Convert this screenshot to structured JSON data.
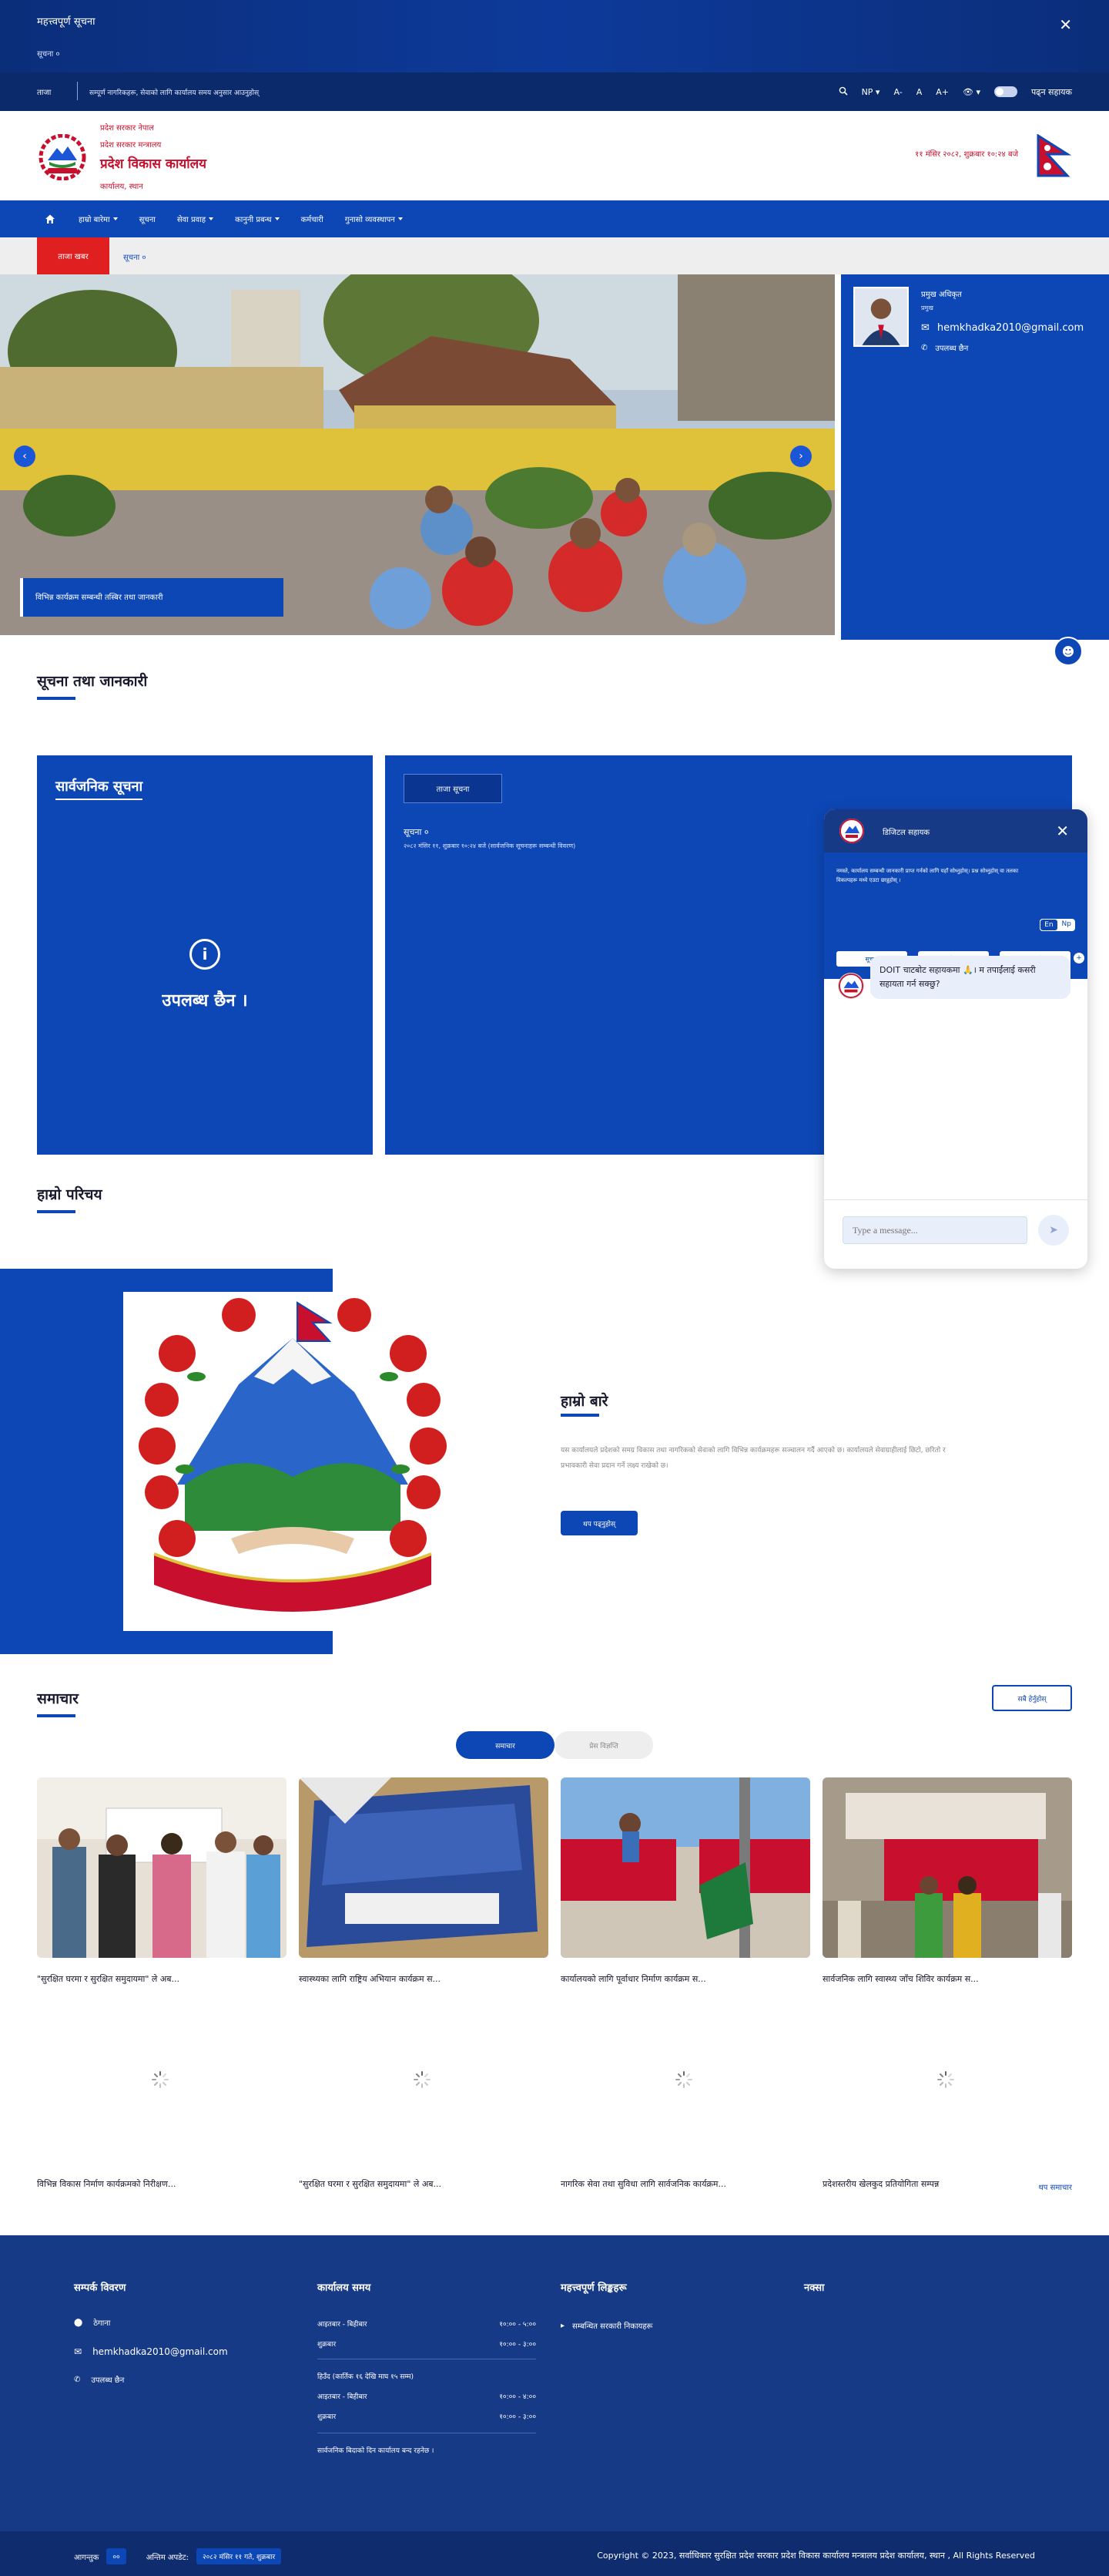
{
  "notice_bar": {
    "title": "महत्त्वपूर्ण सूचना",
    "link": "सूचना ०",
    "close": "✕"
  },
  "util_bar": {
    "label": "ताजा",
    "marquee": "सम्पूर्ण नागरिकहरू, सेवाको लागि कार्यालय समय अनुसार आउनुहोस्",
    "lang": "NP",
    "font_minus": "A-",
    "font_default": "A",
    "font_plus": "A+",
    "theme_label": "डार्क मोड",
    "accessibility": "पढ्न सहायक"
  },
  "header": {
    "line1": "प्रदेश सरकार नेपाल",
    "line2": "प्रदेश सरकार मन्त्रालय",
    "line3": "प्रदेश विकास कार्यालय",
    "line4": "कार्यालय, स्थान",
    "date": "११ मंसिर २०८२, शुक्रबार १०:२४ बजे"
  },
  "nav": {
    "items": [
      {
        "label": "हाम्रो बारेमा",
        "dropdown": true
      },
      {
        "label": "सूचना",
        "dropdown": false
      },
      {
        "label": "सेवा प्रवाह",
        "dropdown": true
      },
      {
        "label": "कानुनी प्रबन्ध",
        "dropdown": true
      },
      {
        "label": "कर्मचारी",
        "dropdown": false
      },
      {
        "label": "गुनासो व्यवस्थापन",
        "dropdown": true
      }
    ]
  },
  "breaking": {
    "tag": "ताजा खबर",
    "text": "सूचना ०"
  },
  "hero": {
    "caption": "विभिन्न कार्यक्रम सम्बन्धी तस्बिर तथा जानकारी",
    "prev": "‹",
    "next": "›"
  },
  "official": {
    "name": "प्रमुख अधिकृत",
    "title": "प्रमुख",
    "email": "hemkhadka2010@gmail.com",
    "phone": "उपलब्ध छैन"
  },
  "sections": {
    "notices_title": "सूचना तथा जानकारी",
    "intro_heading": "हाम्रो परिचय",
    "news_title": "समाचार"
  },
  "notice_left": {
    "title": "सार्वजनिक सूचना",
    "empty": "उपलब्ध छैन ।"
  },
  "notice_right": {
    "tab": "ताजा सूचना",
    "item_title": "सूचना ०",
    "item_sub": "२०८२ मंसिर ११, शुक्रबार १०:२४ बजे (सार्वजनिक सूचनाहरू सम्बन्धी विवरण)"
  },
  "intro": {
    "title": "हाम्रो बारे",
    "text": "यस कार्यालयले प्रदेशको समग्र विकास तथा नागरिकको सेवाको लागि विभिन्न कार्यक्रमहरू सञ्चालन गर्दै आएको छ। कार्यालयले सेवाग्राहीलाई छिटो, छरितो र प्रभावकारी सेवा प्रदान गर्ने लक्ष्य राखेको छ।",
    "button": "थप पढ्नुहोस्"
  },
  "news": {
    "view_all": "सबै हेर्नुहोस्",
    "tabs": [
      "समाचार",
      "प्रेस विज्ञप्ति"
    ],
    "row1": [
      "\"सुरक्षित घरमा र सुरक्षित समुदायमा\" ले अब...",
      "स्वास्थ्यका लागि राष्ट्रिय अभियान कार्यक्रम स...",
      "कार्यालयको लागि पूर्वाधार निर्माण कार्यक्रम स...",
      "सार्वजनिक लागि स्वास्थ्य जाँच शिविर कार्यक्रम स..."
    ],
    "row2": [
      "विभिन्न विकास निर्माण कार्यक्रमको निरीक्षण...",
      "\"सुरक्षित घरमा र सुरक्षित समुदायमा\" ले अब...",
      "नागरिक सेवा तथा सुविधा लागि सार्वजनिक कार्यक्रम...",
      "प्रदेशस्तरीय खेलकुद प्रतियोगिता सम्पन्न"
    ],
    "read_more": "थप समाचार"
  },
  "footer": {
    "contact_title": "सम्पर्क विवरण",
    "address": "ठेगाना",
    "email": "hemkhadka2010@gmail.com",
    "phone": "उपलब्ध छैन",
    "hours_title": "कार्यालय समय",
    "hours": [
      {
        "day": "आइतबार - बिहीबार",
        "time": "१०:०० - ५:००"
      },
      {
        "day": "शुक्रबार",
        "time": "१०:०० - ३:००"
      }
    ],
    "winter_title": "हिउँद (कार्तिक १६ देखि माघ १५ सम्म)",
    "winter_hours": [
      {
        "day": "आइतबार - बिहीबार",
        "time": "१०:०० - ४:००"
      },
      {
        "day": "शुक्रबार",
        "time": "१०:०० - ३:००"
      }
    ],
    "holiday_note": "सार्वजनिक बिदाको दिन कार्यालय बन्द रहनेछ ।",
    "links_title": "महत्त्वपूर्ण लिङ्कहरू",
    "link1": "सम्बन्धित सरकारी निकायहरू",
    "map_title": "नक्सा"
  },
  "bottom_bar": {
    "visits_label": "आगन्तुक",
    "visits_value": "००",
    "updated_label": "अन्तिम अपडेट:",
    "updated_value": "२०८२ मंसिर ११ गते, शुक्रबार",
    "copyright": "Copyright © 2023, सर्वाधिकार सुरक्षित प्रदेश सरकार प्रदेश विकास कार्यालय मन्त्रालय प्रदेश कार्यालय, स्थान , All Rights Reserved"
  },
  "chat": {
    "name": "डिजिटल सहायक",
    "intro": "नमस्ते, कार्यालय सम्बन्धी जानकारी प्राप्त गर्नको लागि यहाँ सोध्नुहोस्। प्रश्न सोध्नुहोस् वा तलका विकल्पहरू मध्ये एउटा छान्नुहोस् ।",
    "lang_en": "En",
    "lang_np": "Np",
    "btn1": "सूचना",
    "btn2": "सेवा",
    "btn3": "सम्पर्क",
    "greeting": "DOIT चाटबोट सहायकमा 🙏। म तपाईंलाई कसरी सहायता गर्न सक्छु?",
    "placeholder": "Type a message..."
  },
  "colors": {
    "primary": "#0d47b5",
    "accent_red": "#c8102e",
    "footer_bg": "#173a87"
  }
}
